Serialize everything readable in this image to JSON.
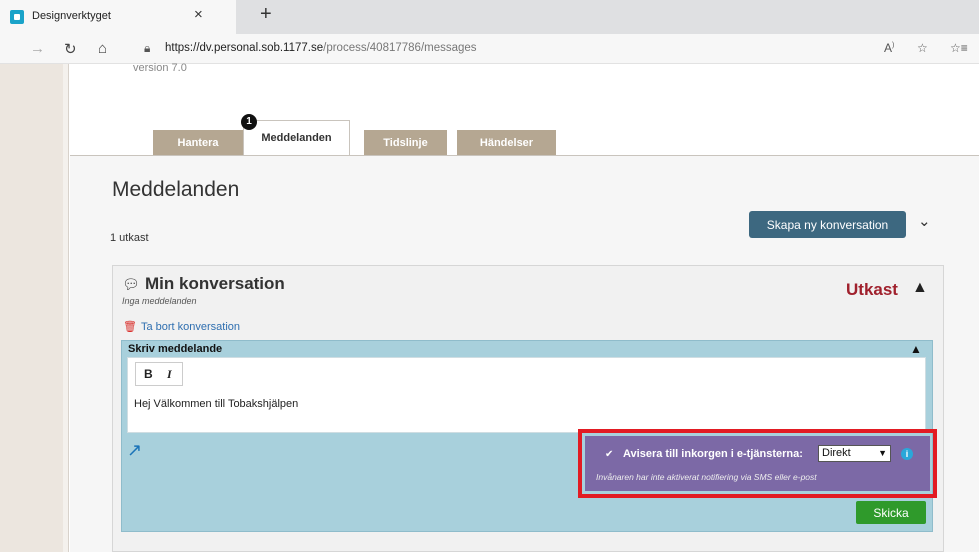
{
  "browser": {
    "tab_title": "Designverktyget",
    "close_glyph": "×",
    "new_tab_glyph": "+",
    "url_host": "https://dv.personal.sob.1177.se",
    "url_path": "/process/40817786/messages",
    "read_aloud_glyph": "A͡",
    "favorites_glyph": "☆",
    "collections_glyph": "☆≡"
  },
  "page": {
    "version_text": "version 7.0",
    "tabs": [
      {
        "label": "Hantera"
      },
      {
        "label": "Meddelanden"
      },
      {
        "label": "Tidslinje"
      },
      {
        "label": "Händelser"
      }
    ],
    "tab_badge": "1",
    "title": "Meddelanden",
    "draft_count": "1 utkast",
    "create_button_label": "Skapa ny konversation"
  },
  "conversation": {
    "title": "Min konversation",
    "subtitle": "Inga meddelanden",
    "status": "Utkast",
    "delete_label": "Ta bort konversation",
    "compose_header": "Skriv meddelande",
    "bold_label": "B",
    "italic_label": "I",
    "message_text": "Hej Välkommen till Tobakshjälpen",
    "notify_label": "Avisera till inkorgen i e-tjänsterna:",
    "notify_selected": "Direkt",
    "notify_note": "Invånaren har inte aktiverat notifiering via SMS eller e-post",
    "send_label": "Skicka"
  },
  "colors": {
    "tab_inactive": "#b5a792",
    "primary_button": "#3d6880",
    "status_red": "#a0212d",
    "compose_bg": "#a8d0dc",
    "notify_bg": "#7c69a6",
    "highlight": "#e21b23",
    "send_green": "#2f9a2b"
  }
}
